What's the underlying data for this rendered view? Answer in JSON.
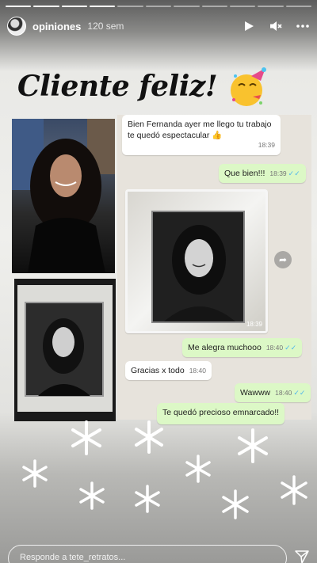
{
  "story": {
    "segments_total": 11,
    "segments_done": 4
  },
  "header": {
    "username": "opiniones",
    "time_ago": "120 sem",
    "icons": [
      "play-icon",
      "volume-icon",
      "more-icon"
    ]
  },
  "post": {
    "title": "Cliente feliz!",
    "emoji": "party-face-emoji"
  },
  "chat": {
    "messages": [
      {
        "kind": "in",
        "text": "Bien Fernanda ayer me llego tu trabajo te quedó espectacular 👍",
        "time": "18:39"
      },
      {
        "kind": "out",
        "text": "Que bien!!!",
        "time": "18:39"
      },
      {
        "kind": "image",
        "time": "18:39"
      },
      {
        "kind": "out",
        "text": "Me alegra muchooo",
        "time": "18:40"
      },
      {
        "kind": "in",
        "text": "Gracias x todo",
        "time": "18:40"
      },
      {
        "kind": "out",
        "text": "Wawww",
        "time": "18:40"
      },
      {
        "kind": "out",
        "text": "Te quedó precioso emnarcado!!",
        "time": ""
      }
    ]
  },
  "reply": {
    "placeholder": "Responde a tete_retratos..."
  },
  "colors": {
    "incoming_bubble": "#ffffff",
    "outgoing_bubble": "#dcf8c6",
    "chat_background": "#e7e3dc",
    "read_ticks": "#4fb6ec"
  }
}
